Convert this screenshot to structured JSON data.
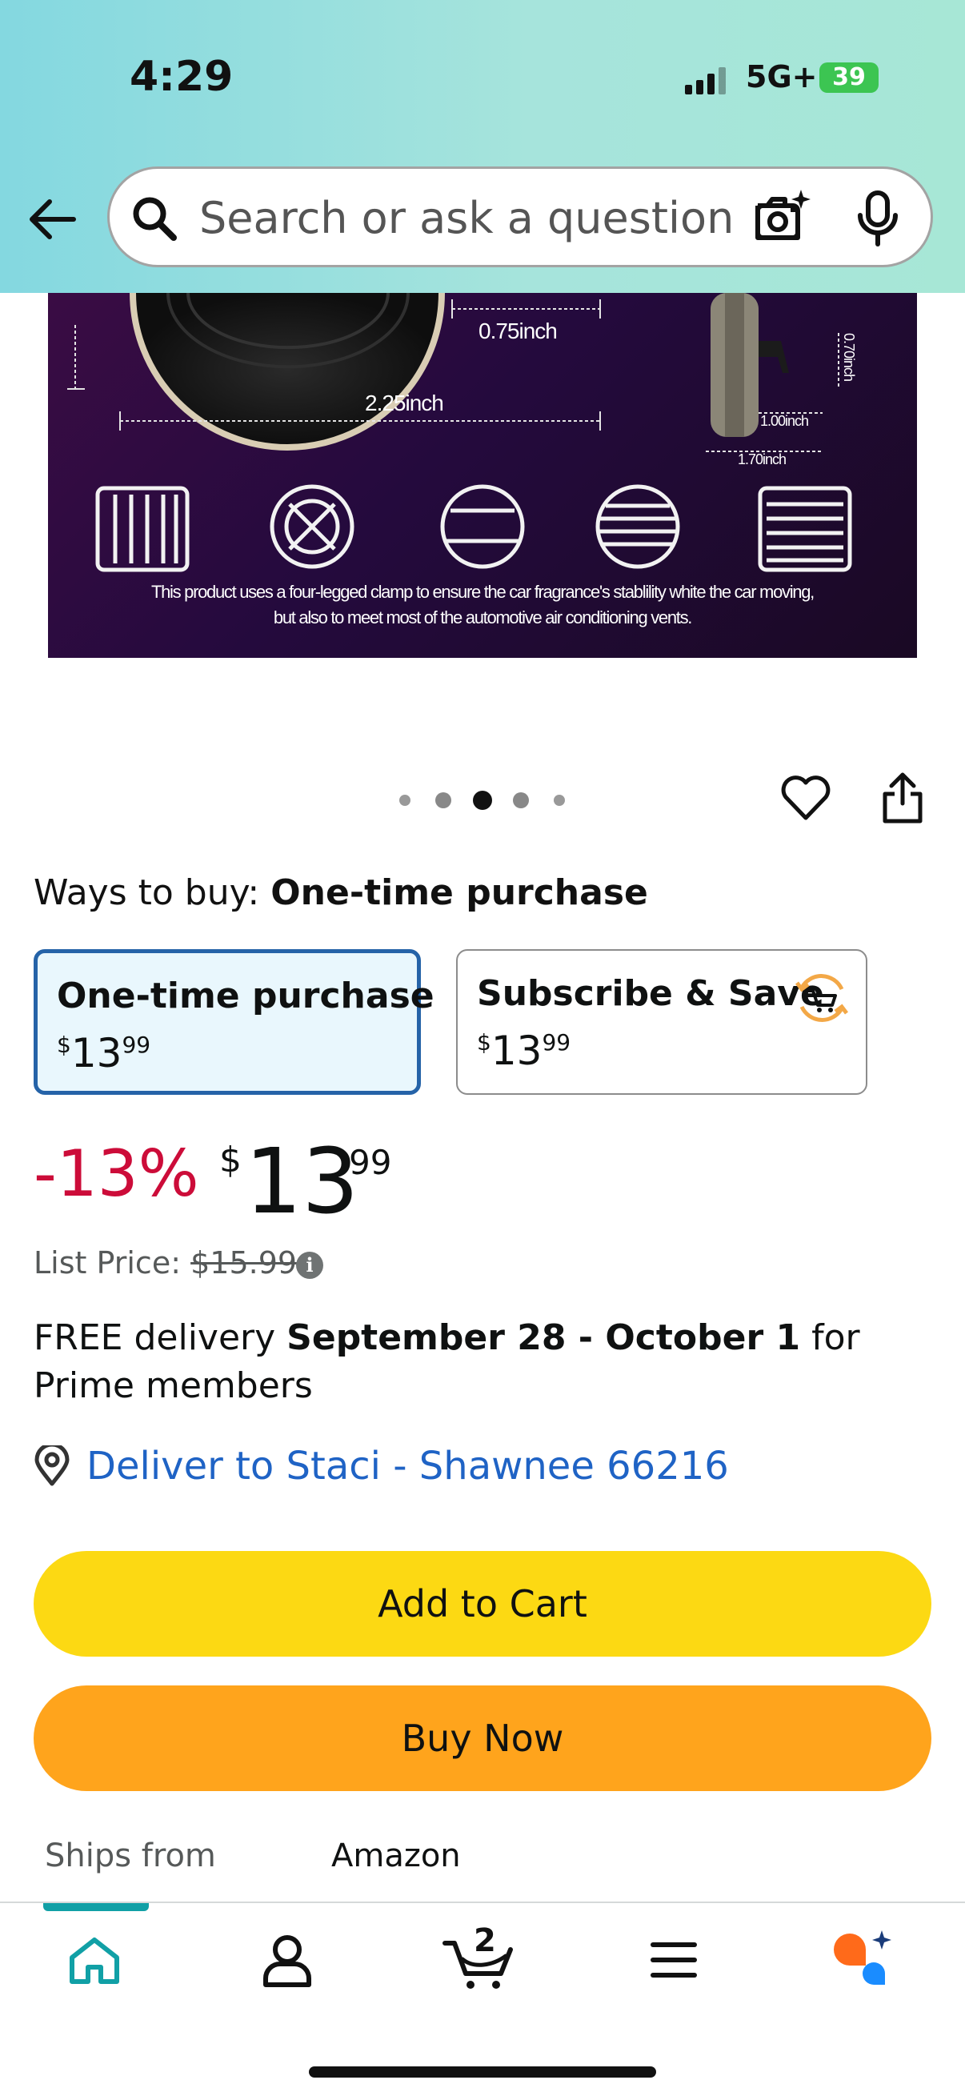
{
  "status_bar": {
    "time": "4:29",
    "network": "5G+",
    "battery": "39"
  },
  "search": {
    "placeholder": "Search or ask a question"
  },
  "icons": {
    "back": "back-arrow-icon",
    "search": "search-icon",
    "camera": "camera-icon",
    "mic": "mic-icon",
    "heart": "heart-icon",
    "share": "share-icon",
    "location": "location-pin-icon",
    "info": "info-icon",
    "subscribe": "subscribe-cart-icon"
  },
  "product_image": {
    "dims": {
      "d1": "0.75inch",
      "d2": "2.25inch",
      "d3": "0.70inch",
      "d4": "1.00inch",
      "d5": "1.70inch"
    },
    "caption_line1": "This product uses a four-legged clamp to ensure the car fragrance's stablility white the car moving,",
    "caption_line2": "but also to meet most of the automotive air conditioning vents."
  },
  "carousel": {
    "count": 5,
    "active_index": 2
  },
  "ways_to_buy": {
    "label": "Ways to buy:",
    "selected": "One-time purchase"
  },
  "options": {
    "one_time": {
      "title": "One-time purchase",
      "currency": "$",
      "whole": "13",
      "cents": "99"
    },
    "subscribe": {
      "title": "Subscribe & Save",
      "currency": "$",
      "whole": "13",
      "cents": "99"
    }
  },
  "price": {
    "discount": "-13%",
    "currency": "$",
    "whole": "13",
    "cents": "99",
    "list_label": "List Price:",
    "list_value": "$15.99"
  },
  "delivery": {
    "prefix": "FREE delivery ",
    "dates": "September 28 - October 1",
    "suffix": " for Prime members"
  },
  "deliver_to": "Deliver to Staci - Shawnee 66216",
  "buttons": {
    "add_to_cart": "Add to Cart",
    "buy_now": "Buy Now"
  },
  "ships_from": {
    "label": "Ships from",
    "value": "Amazon"
  },
  "bottom_nav": {
    "cart_count": "2",
    "items": [
      "home",
      "account",
      "cart",
      "menu",
      "rufus"
    ],
    "active": "home"
  },
  "colors": {
    "accent": "#11a0a6",
    "add_to_cart": "#fcd913",
    "buy_now": "#ffa41c",
    "discount": "#cc0c39",
    "link": "#1f63c5"
  }
}
